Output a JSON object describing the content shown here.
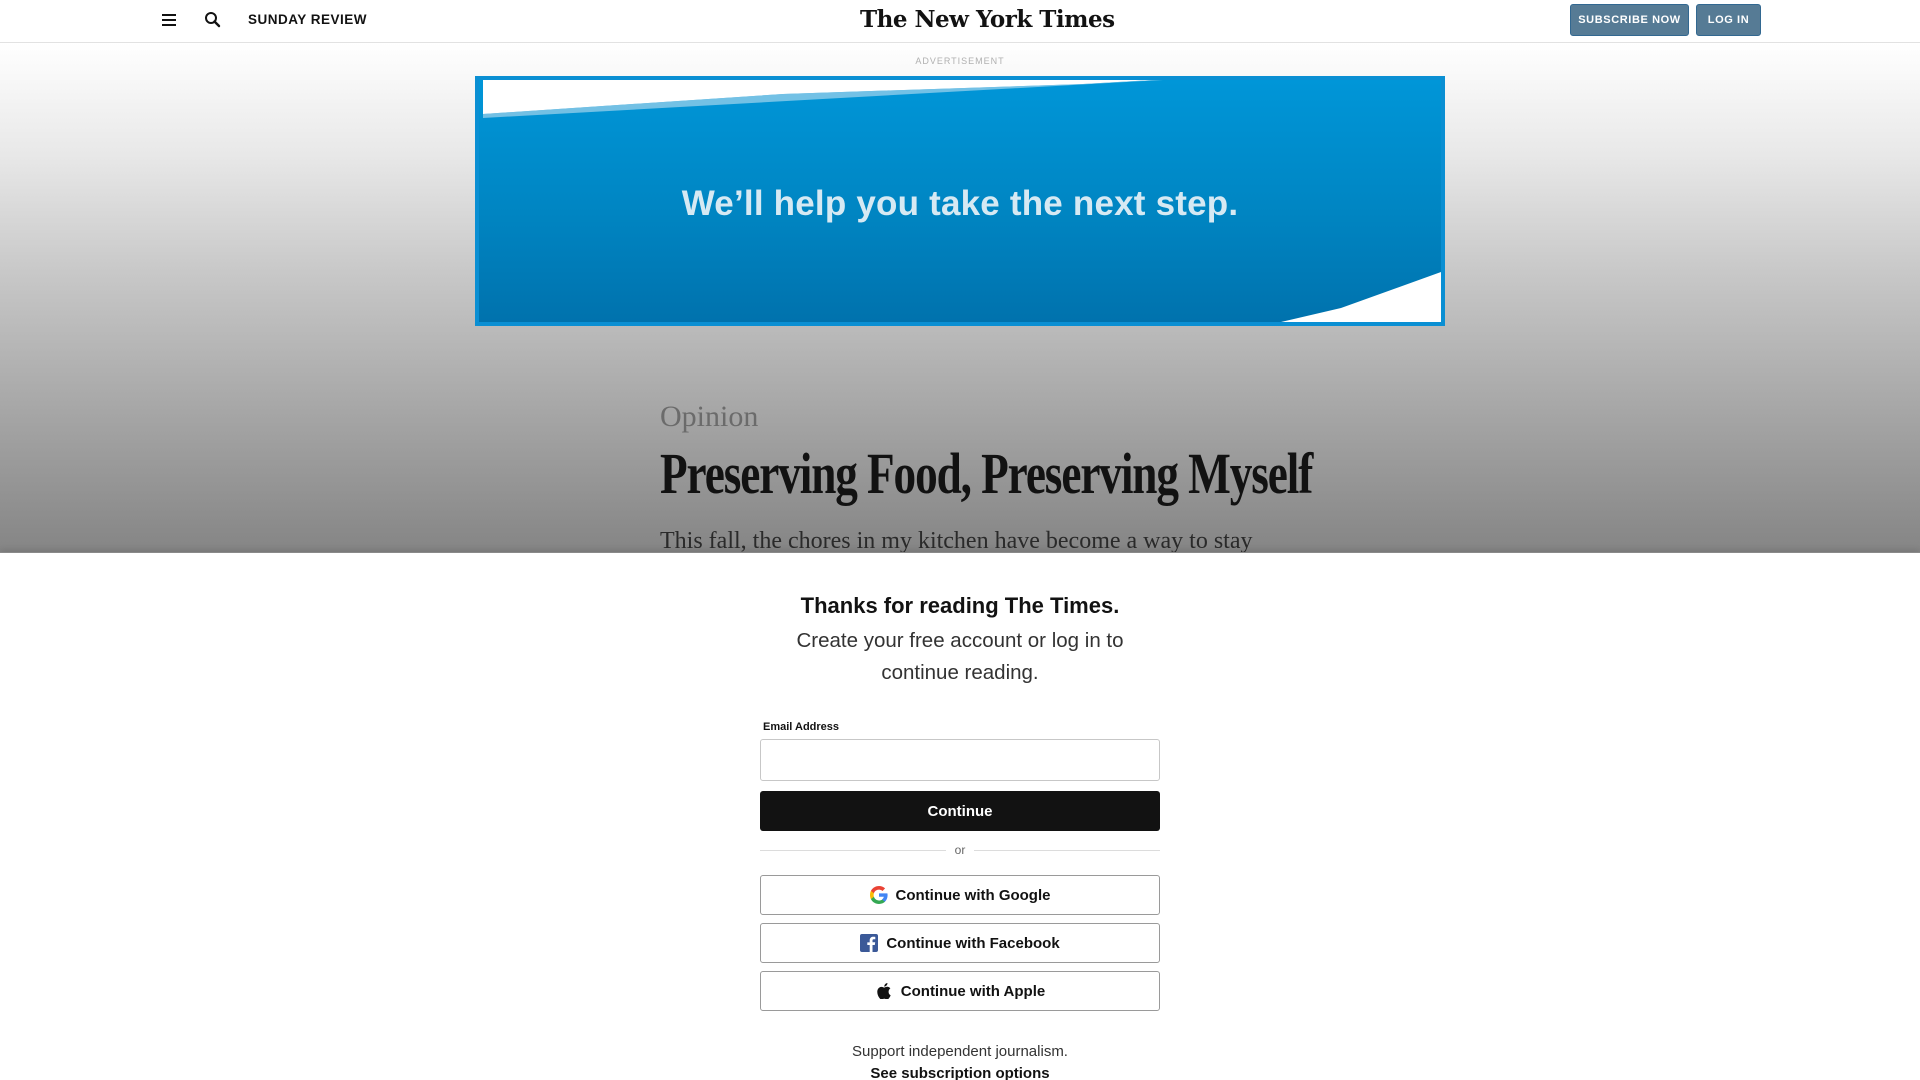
{
  "header": {
    "section": "SUNDAY REVIEW",
    "logo": "The New York Times",
    "subscribe_label": "SUBSCRIBE NOW",
    "login_label": "LOG IN",
    "menu_icon": "hamburger-menu-icon",
    "search_icon": "search-icon",
    "button_color": "#567b95"
  },
  "ad": {
    "label": "ADVERTISEMENT",
    "text": "We’ll help you take the next step.",
    "background": "#0096d8"
  },
  "article": {
    "kicker": "Opinion",
    "headline": "Preserving Food, Preserving Myself",
    "deck": "This fall, the chores in my kitchen have become a way to stay"
  },
  "paywall": {
    "title": "Thanks for reading The Times.",
    "subtitle": "Create your free account or log in to continue reading.",
    "email_label": "Email Address",
    "email_value": "",
    "continue_label": "Continue",
    "or_label": "or",
    "google_label": "Continue with Google",
    "facebook_label": "Continue with Facebook",
    "apple_label": "Continue with Apple",
    "support_text": "Support independent journalism.",
    "subscription_link": "See subscription options"
  }
}
